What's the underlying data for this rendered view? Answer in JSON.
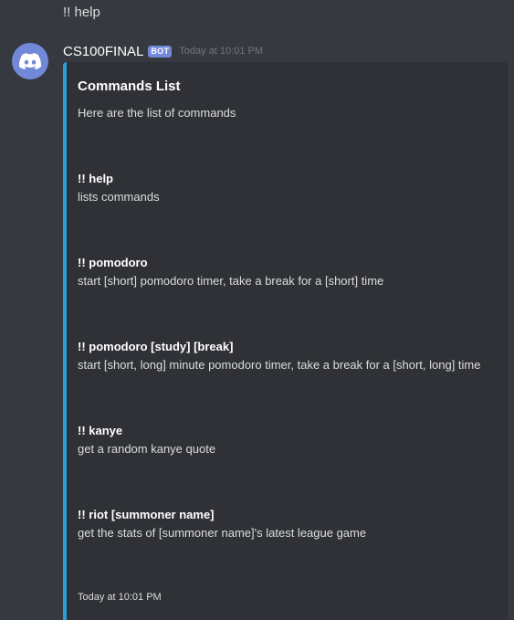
{
  "user_message": {
    "text": "!! help"
  },
  "bot_message": {
    "username": "CS100FINAL",
    "tag": "BOT",
    "timestamp": "Today at 10:01 PM",
    "avatar_icon": "discord-logo-icon",
    "embed": {
      "accent_color": "#2d9fd6",
      "title": "Commands List",
      "description": "Here are the list of commands",
      "fields": [
        {
          "name": "!! help",
          "value": "lists commands"
        },
        {
          "name": "!! pomodoro",
          "value": "start [short] pomodoro timer, take a break for a [short] time"
        },
        {
          "name": "!! pomodoro [study] [break]",
          "value": "start [short, long] minute pomodoro timer, take a break for a [short, long] time"
        },
        {
          "name": "!! kanye",
          "value": "get a random kanye quote"
        },
        {
          "name": "!! riot [summoner name]",
          "value": "get the stats of [summoner name]'s latest league game"
        }
      ],
      "footer": "Today at 10:01 PM"
    }
  },
  "colors": {
    "background": "#36393f",
    "embed_background": "#2f3136",
    "blurple": "#7289da"
  }
}
